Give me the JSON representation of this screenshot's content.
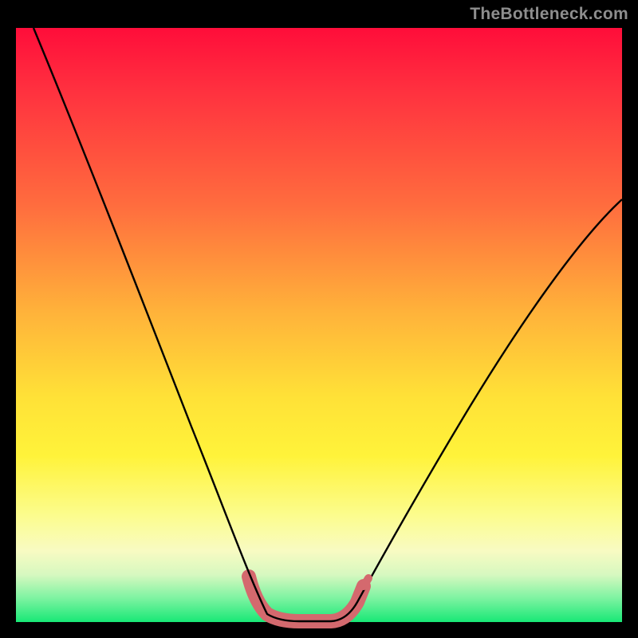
{
  "watermark": "TheBottleneck.com",
  "chart_data": {
    "type": "line",
    "title": "",
    "xlabel": "",
    "ylabel": "",
    "xlim": [
      0,
      100
    ],
    "ylim": [
      0,
      100
    ],
    "x": [
      0,
      5,
      10,
      15,
      20,
      25,
      30,
      35,
      38,
      40,
      42,
      44,
      46,
      48,
      50,
      52,
      55,
      60,
      65,
      70,
      75,
      80,
      85,
      90,
      95,
      100
    ],
    "values": [
      100,
      90,
      80,
      70,
      60,
      50,
      40,
      28,
      18,
      9,
      3,
      1,
      0,
      0,
      0,
      1,
      3,
      9,
      18,
      27,
      35,
      42,
      48,
      54,
      59,
      63
    ],
    "series": [
      {
        "name": "bottleneck-curve",
        "x": [
          0,
          5,
          10,
          15,
          20,
          25,
          30,
          35,
          38,
          40,
          42,
          44,
          46,
          48,
          50,
          52,
          55,
          60,
          65,
          70,
          75,
          80,
          85,
          90,
          95,
          100
        ],
        "values": [
          100,
          90,
          80,
          70,
          60,
          50,
          40,
          28,
          18,
          9,
          3,
          1,
          0,
          0,
          0,
          1,
          3,
          9,
          18,
          27,
          35,
          42,
          48,
          54,
          59,
          63
        ]
      }
    ],
    "highlight_range_x": [
      40,
      55
    ],
    "colors": {
      "curve": "#000000",
      "highlight": "#d4696e",
      "gradient_top": "#ff0d3a",
      "gradient_bottom": "#18e876"
    }
  }
}
